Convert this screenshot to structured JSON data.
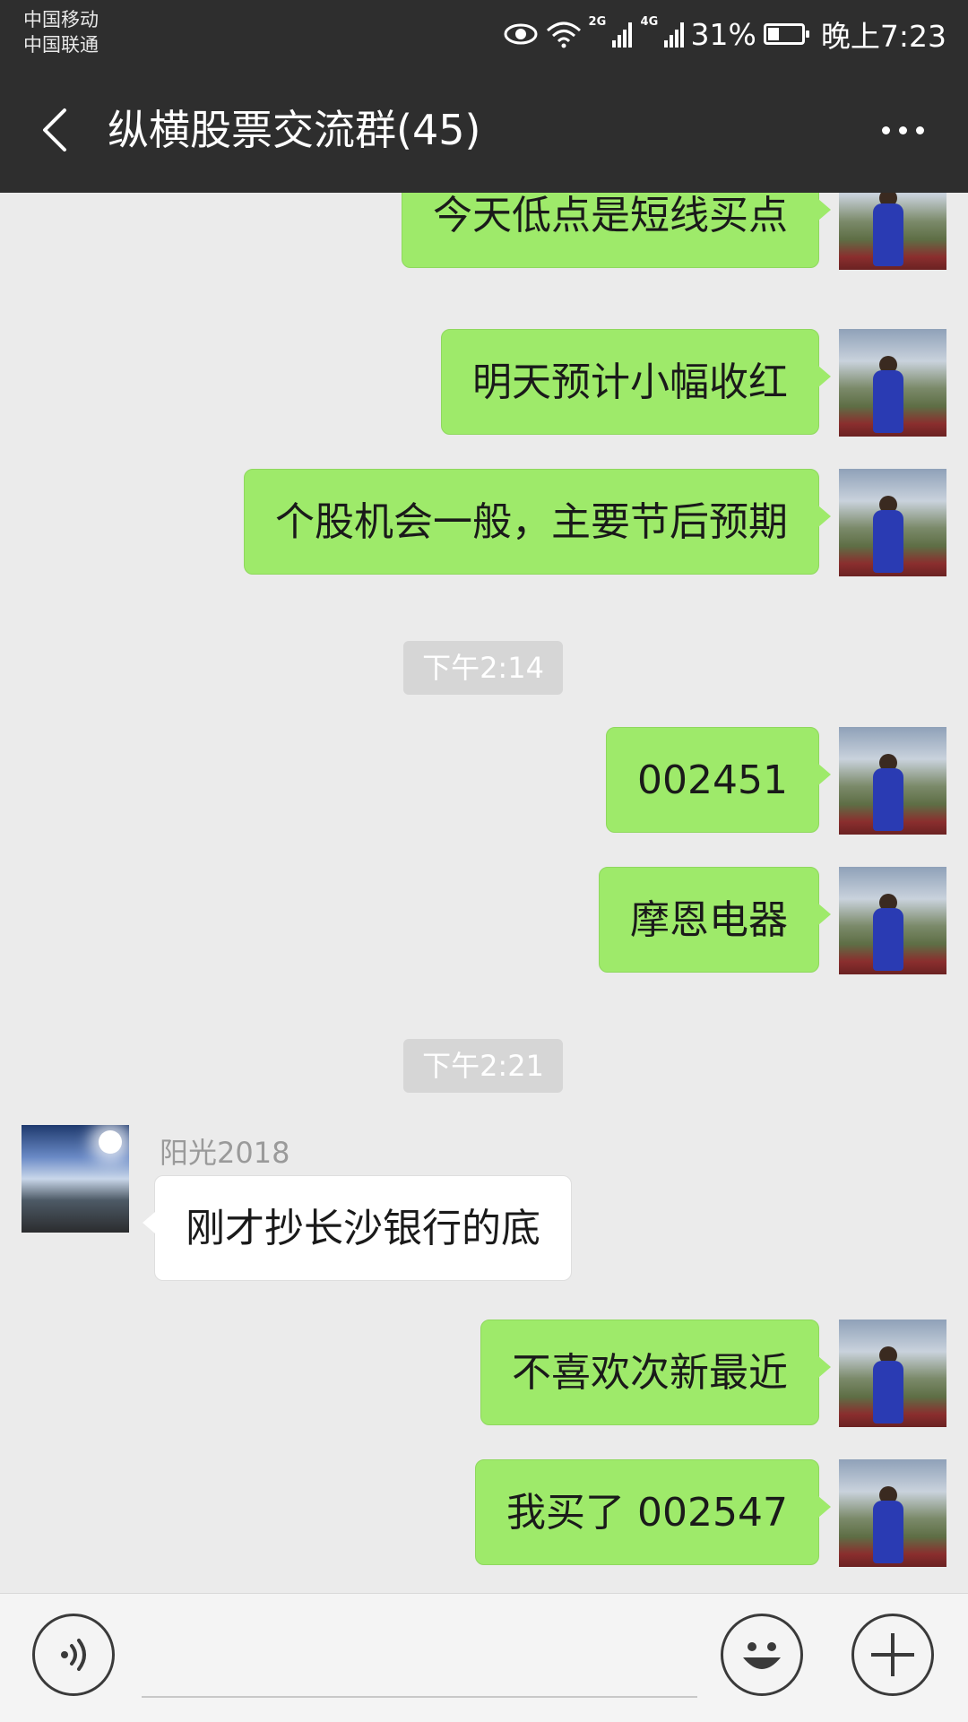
{
  "status": {
    "carrier1": "中国移动",
    "carrier2": "中国联通",
    "net1": "2G",
    "net2": "4G",
    "battery": "31%",
    "time": "晚上7:23"
  },
  "header": {
    "title": "纵横股票交流群(45)",
    "back_icon": "chevron-left-icon",
    "menu_icon": "more-icon"
  },
  "messages": [
    {
      "text": "今天低点是短线买点"
    },
    {
      "text": "明天预计小幅收红"
    },
    {
      "text": "个股机会一般，主要节后预期"
    },
    {
      "timestamp": "下午2:14"
    },
    {
      "text": "002451"
    },
    {
      "text": "摩恩电器"
    },
    {
      "timestamp": "下午2:21"
    },
    {
      "sender": "阳光2018",
      "text": "刚才抄长沙银行的底"
    },
    {
      "text": "不喜欢次新最近"
    },
    {
      "text": "我买了 002547"
    }
  ],
  "colors": {
    "bar_bg": "#2e2e2e",
    "chat_bg": "#ebebeb",
    "self_bubble": "#9eea6a",
    "other_bubble": "#ffffff"
  }
}
